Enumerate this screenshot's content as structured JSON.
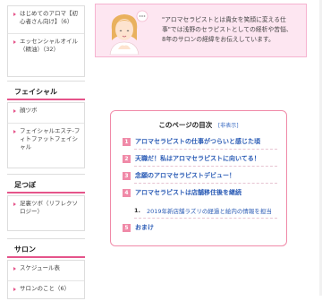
{
  "sidebar": {
    "top_items": [
      {
        "label": "はじめてのアロマ【初心者さん向け】（6）"
      },
      {
        "label": "エッセンシャルオイル（精油）（32）"
      }
    ],
    "sections": [
      {
        "heading": "フェイシャル",
        "items": [
          {
            "label": "顔ツボ"
          },
          {
            "label": "フェイシャルエステ-フィトファットフェイシャル"
          }
        ]
      },
      {
        "heading": "足つぼ",
        "items": [
          {
            "label": "足裏ツボ（リフレクソロジー）"
          }
        ]
      },
      {
        "heading": "サロン",
        "items": [
          {
            "label": "スケジュール表"
          },
          {
            "label": "サロンのこと（6）"
          }
        ]
      }
    ]
  },
  "intro": {
    "line1": "\"アロマセラピストとは貴女を笑顔に変える仕",
    "line2": "事\"では浅野のセラピストとしての経析や苦悩、",
    "line3": "8年のサロンの経緯をお伝えしています。"
  },
  "toc": {
    "title": "このページの目次",
    "toggle": "[非表示]",
    "items": [
      {
        "num": "1",
        "label": "アロマセラピストの仕事がつらいと感じた頃"
      },
      {
        "num": "2",
        "label": "天職だ！私はアロマセラピストに向いてる！"
      },
      {
        "num": "3",
        "label": "念願のアロマセラピストデビュー！"
      },
      {
        "num": "4",
        "label": "アロマセラピストは店舗移住後を継続"
      }
    ],
    "subitem": {
      "num": "1.",
      "label": "2019年新店舗ラズリの経過と絵内の情報を担当"
    },
    "last": {
      "num": "5",
      "label": "おまけ"
    }
  }
}
